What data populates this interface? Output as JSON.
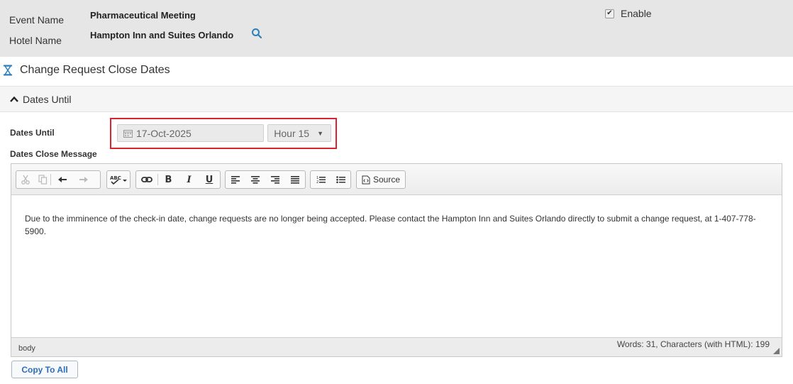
{
  "header": {
    "event_name_label": "Event Name",
    "event_name_value": "Pharmaceutical Meeting",
    "hotel_name_label": "Hotel Name",
    "hotel_name_value": "Hampton Inn and Suites Orlando",
    "enable_label": "Enable",
    "enable_checked": true
  },
  "section": {
    "title": "Change Request Close Dates"
  },
  "panel": {
    "title": "Dates Until",
    "collapsed": false
  },
  "form": {
    "dates_until_label": "Dates Until",
    "date_value": "17-Oct-2025",
    "hour_value": "Hour 15",
    "close_message_label": "Dates Close Message"
  },
  "editor": {
    "toolbar": {
      "cut": "cut-icon",
      "copy": "copy-icon",
      "undo": "undo-icon",
      "redo": "redo-icon",
      "spellcheck": "spellcheck-icon",
      "link": "link-icon",
      "bold": "B",
      "italic": "I",
      "underline": "U",
      "source_label": "Source"
    },
    "content": "Due to the imminence of the check-in date, change requests are no longer being accepted. Please contact the Hampton Inn and Suites Orlando directly to submit a change request, at 1-407-778-5900.",
    "status_path": "body",
    "status_count": "Words: 31, Characters (with HTML): 199"
  },
  "buttons": {
    "copy_to_all": "Copy To All"
  },
  "colors": {
    "header_bg": "#e6e6e6",
    "accent_blue": "#2a7fbf",
    "highlight_red": "#d9232e"
  }
}
